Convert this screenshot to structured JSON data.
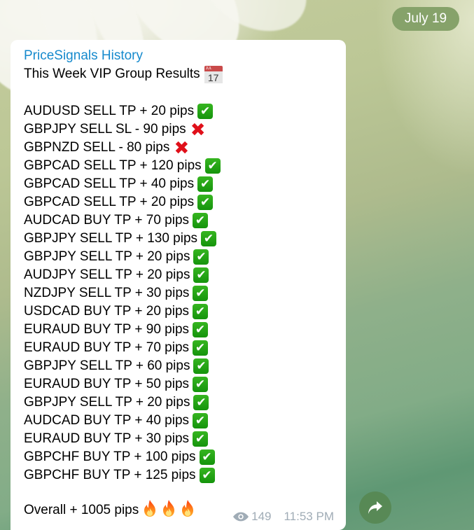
{
  "date_separator": "July 19",
  "message": {
    "sender": "PriceSignals History",
    "title": "This Week VIP Group Results",
    "title_icon": "calendar-icon",
    "calendar_icon": {
      "month": "JUL",
      "day": "17"
    },
    "signals": [
      {
        "text": "AUDUSD SELL TP + 20 pips",
        "status_icon": "check-mark-icon",
        "result": "win"
      },
      {
        "text": "GBPJPY SELL SL - 90 pips",
        "status_icon": "cross-mark-icon",
        "result": "loss"
      },
      {
        "text": "GBPNZD SELL - 80 pips",
        "status_icon": "cross-mark-icon",
        "result": "loss"
      },
      {
        "text": "GBPCAD SELL TP + 120 pips",
        "status_icon": "check-mark-icon",
        "result": "win"
      },
      {
        "text": "GBPCAD SELL TP + 40 pips",
        "status_icon": "check-mark-icon",
        "result": "win"
      },
      {
        "text": "GBPCAD SELL TP + 20 pips",
        "status_icon": "check-mark-icon",
        "result": "win"
      },
      {
        "text": "AUDCAD BUY TP + 70 pips",
        "status_icon": "check-mark-icon",
        "result": "win"
      },
      {
        "text": "GBPJPY SELL TP + 130 pips",
        "status_icon": "check-mark-icon",
        "result": "win"
      },
      {
        "text": "GBPJPY SELL TP + 20 pips",
        "status_icon": "check-mark-icon",
        "result": "win"
      },
      {
        "text": "AUDJPY SELL TP + 20 pips",
        "status_icon": "check-mark-icon",
        "result": "win"
      },
      {
        "text": "NZDJPY SELL TP + 30 pips",
        "status_icon": "check-mark-icon",
        "result": "win"
      },
      {
        "text": "USDCAD BUY TP + 20 pips",
        "status_icon": "check-mark-icon",
        "result": "win"
      },
      {
        "text": "EURAUD BUY TP + 90 pips",
        "status_icon": "check-mark-icon",
        "result": "win"
      },
      {
        "text": "EURAUD BUY TP + 70 pips",
        "status_icon": "check-mark-icon",
        "result": "win"
      },
      {
        "text": "GBPJPY SELL TP + 60 pips",
        "status_icon": "check-mark-icon",
        "result": "win"
      },
      {
        "text": "EURAUD BUY TP + 50 pips",
        "status_icon": "check-mark-icon",
        "result": "win"
      },
      {
        "text": "GBPJPY SELL TP + 20 pips",
        "status_icon": "check-mark-icon",
        "result": "win"
      },
      {
        "text": "AUDCAD BUY TP + 40 pips",
        "status_icon": "check-mark-icon",
        "result": "win"
      },
      {
        "text": "EURAUD BUY TP + 30 pips",
        "status_icon": "check-mark-icon",
        "result": "win"
      },
      {
        "text": "GBPCHF BUY TP + 100 pips",
        "status_icon": "check-mark-icon",
        "result": "win"
      },
      {
        "text": "GBPCHF BUY TP + 125 pips",
        "status_icon": "check-mark-icon",
        "result": "win"
      }
    ],
    "overall": "Overall + 1005 pips",
    "overall_icons": [
      "fire-icon",
      "fire-icon",
      "fire-icon"
    ],
    "views": "149",
    "time": "11:53 PM"
  },
  "actions": {
    "share_icon": "share-icon"
  },
  "colors": {
    "sender": "#168acd",
    "date_pill": "#86a26a",
    "meta_text": "#a0acb6",
    "check_green": "#1fa413",
    "cross_red": "#e0101a"
  }
}
